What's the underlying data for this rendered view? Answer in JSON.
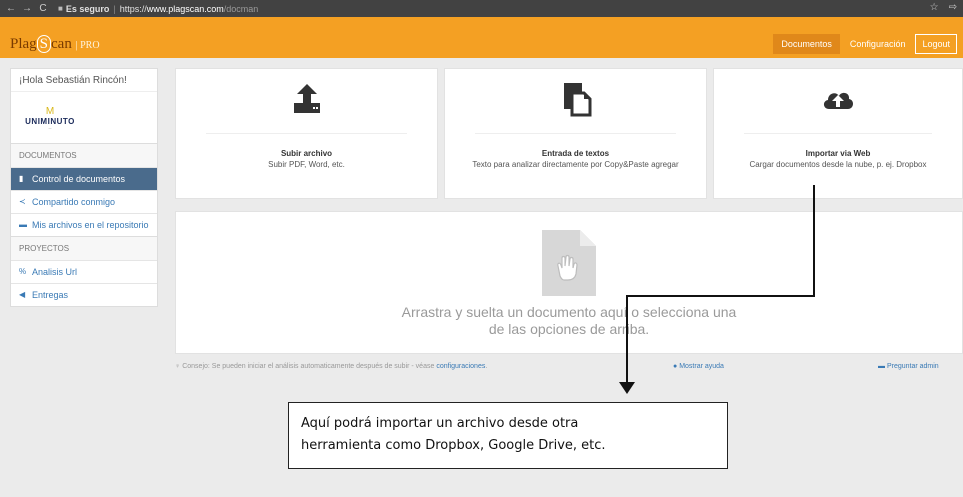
{
  "browser": {
    "nav_back": "←",
    "nav_forward": "→",
    "reload": "C",
    "secure_label": "Es seguro",
    "url_proto": "https://",
    "url_host": "www.plagscan.com",
    "url_path": "/docman"
  },
  "app": {
    "logo_plag": "Plag",
    "logo_s": "S",
    "logo_can": "can",
    "logo_pro": "| PRO",
    "nav": {
      "documents": "Documentos",
      "settings": "Configuración",
      "logout": "Logout"
    }
  },
  "sidebar": {
    "greeting": "¡Hola Sebastián Rincón!",
    "org_name": "UNIMINUTO",
    "org_mark": "M",
    "section_docs": "DOCUMENTOS",
    "items": [
      {
        "label": "Control de documentos",
        "icon": "▮"
      },
      {
        "label": "Compartido conmigo",
        "icon": "≺"
      },
      {
        "label": "Mis archivos en el repositorio",
        "icon": "▬"
      }
    ],
    "section_projects": "PROYECTOS",
    "project_items": [
      {
        "label": "Analisis Url",
        "icon": "%"
      },
      {
        "label": "Entregas",
        "icon": "◀"
      }
    ]
  },
  "cards": [
    {
      "title": "Subir archivo",
      "desc": "Subir PDF, Word, etc.",
      "icon": "upload-icon"
    },
    {
      "title": "Entrada de textos",
      "desc": "Texto para analizar directamente por Copy&Paste agregar",
      "icon": "paste-icon"
    },
    {
      "title": "Importar via Web",
      "desc": "Cargar documentos desde la nube, p. ej. Dropbox",
      "icon": "cloud-upload-icon"
    }
  ],
  "dropzone": {
    "line1": "Arrastra y suelta un documento aquí o selecciona una",
    "line2": "de las opciones de arriba."
  },
  "footer": {
    "tip_prefix": "Consejo: Se pueden iniciar el análisis automaticamente después de subir - véase",
    "tip_link": "configuraciones",
    "show_help": "Mostrar ayuda",
    "ask_admin": "Preguntar admin"
  },
  "annotation": {
    "line1": "Aquí podrá importar un archivo desde otra",
    "line2": "herramienta como Dropbox, Google Drive, etc."
  }
}
